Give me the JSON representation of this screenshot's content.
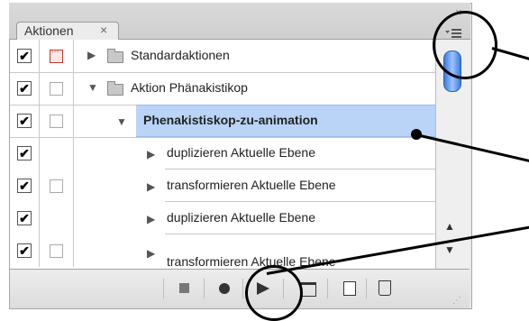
{
  "panel": {
    "tab_label": "Aktionen",
    "tab_close": "×",
    "window_close": "×"
  },
  "rows": [
    {
      "label": "Standardaktionen",
      "checked": "✔",
      "expanded": false,
      "level": 0,
      "dialog": "red"
    },
    {
      "label": "Aktion Phänakistikop",
      "checked": "✔",
      "expanded": true,
      "level": 0,
      "dialog": "empty"
    },
    {
      "label": "Phenakistiskop-zu-animation",
      "checked": "✔",
      "expanded": true,
      "level": 1,
      "dialog": "empty",
      "selected": true
    },
    {
      "label": "duplizieren Aktuelle Ebene",
      "checked": "✔",
      "expanded": false,
      "level": 2,
      "dialog": "none"
    },
    {
      "label": "transformieren Aktuelle Ebene",
      "checked": "✔",
      "expanded": false,
      "level": 2,
      "dialog": "empty"
    },
    {
      "label": "duplizieren Aktuelle Ebene",
      "checked": "✔",
      "expanded": false,
      "level": 2,
      "dialog": "none"
    },
    {
      "label": "transformieren Aktuelle Ebene",
      "checked": "✔",
      "expanded": false,
      "level": 2,
      "dialog": "empty"
    }
  ],
  "colors": {
    "selection": "#b9d4f7",
    "scroll_thumb": "#3d7be0",
    "annotation": "#000000"
  },
  "icons": [
    "panel-menu-icon",
    "stop-icon",
    "record-icon",
    "play-icon",
    "new-set-icon",
    "new-action-icon",
    "trash-icon"
  ]
}
